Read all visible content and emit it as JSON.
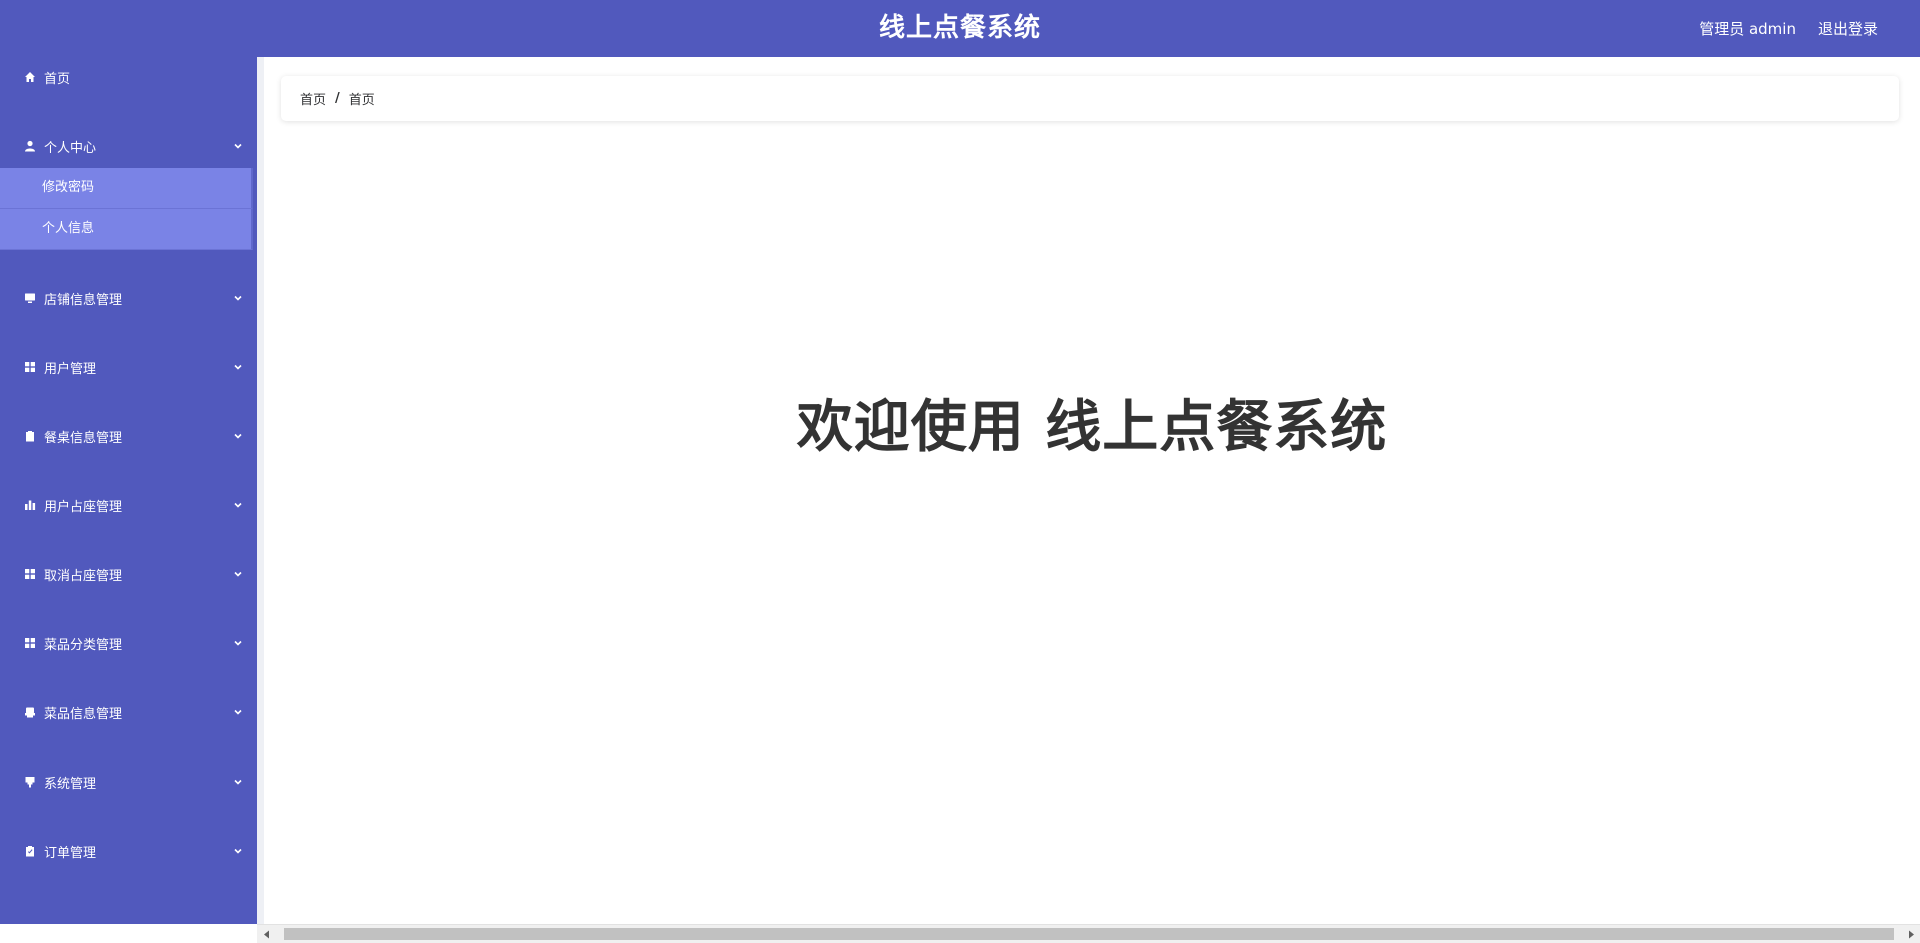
{
  "header": {
    "title": "线上点餐系统",
    "user_label": "管理员 admin",
    "logout_label": "退出登录"
  },
  "sidebar": {
    "items": [
      {
        "label": "首页",
        "icon": "home-icon",
        "expandable": false
      },
      {
        "label": "个人中心",
        "icon": "user-icon",
        "expandable": true,
        "expanded": true,
        "children": [
          {
            "label": "修改密码"
          },
          {
            "label": "个人信息"
          }
        ]
      },
      {
        "label": "店铺信息管理",
        "icon": "monitor-icon",
        "expandable": true
      },
      {
        "label": "用户管理",
        "icon": "grid-icon",
        "expandable": true
      },
      {
        "label": "餐桌信息管理",
        "icon": "clipboard-icon",
        "expandable": true
      },
      {
        "label": "用户占座管理",
        "icon": "bar-chart-icon",
        "expandable": true
      },
      {
        "label": "取消占座管理",
        "icon": "grid-icon",
        "expandable": true
      },
      {
        "label": "菜品分类管理",
        "icon": "grid-icon",
        "expandable": true
      },
      {
        "label": "菜品信息管理",
        "icon": "printer-icon",
        "expandable": true
      },
      {
        "label": "系统管理",
        "icon": "pin-icon",
        "expandable": true
      },
      {
        "label": "订单管理",
        "icon": "clipboard-check-icon",
        "expandable": true
      }
    ]
  },
  "breadcrumb": {
    "items": [
      "首页",
      "首页"
    ],
    "separator": "/"
  },
  "main": {
    "welcome_text": "欢迎使用 线上点餐系统"
  },
  "colors": {
    "primary": "#5159bd",
    "submenu_bg": "#7a83e6",
    "text_dark": "#333333"
  }
}
